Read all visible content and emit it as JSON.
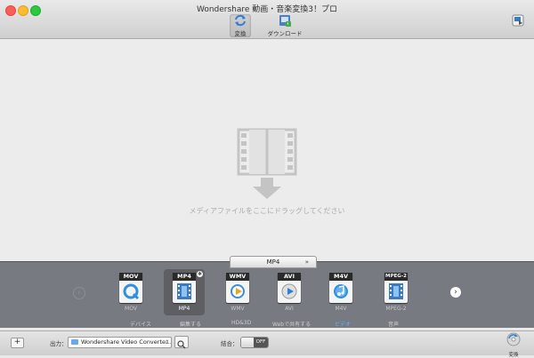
{
  "window": {
    "title": "Wondershare 動画・音楽変換3！プロ"
  },
  "toolbar": {
    "convert_label": "変換",
    "download_label": "ダウンロード"
  },
  "dropzone": {
    "hint": "メディアファイルをここにドラッグしてください"
  },
  "format_dropdown": {
    "selected": "MP4"
  },
  "formats": [
    {
      "tag": "MOV",
      "label": "MOV",
      "icon": "quicktime-icon"
    },
    {
      "tag": "MP4",
      "label": "MP4",
      "icon": "film-strip-icon",
      "selected": true
    },
    {
      "tag": "WMV",
      "label": "WMV",
      "icon": "windows-media-play-icon"
    },
    {
      "tag": "AVI",
      "label": "AVI",
      "icon": "play-icon"
    },
    {
      "tag": "M4V",
      "label": "M4V",
      "icon": "itunes-icon"
    },
    {
      "tag": "MPEG-2",
      "label": "MPEG-2",
      "icon": "film-strip-icon"
    }
  ],
  "categories": [
    {
      "label": "デバイス"
    },
    {
      "label": "編集する"
    },
    {
      "label": "HD&3D"
    },
    {
      "label": "Webで共有する"
    },
    {
      "label": "ビデオ",
      "active": true
    },
    {
      "label": "音声"
    }
  ],
  "bottom": {
    "output_label": "出力：",
    "output_value": "Wondershare Video Converte...",
    "merge_label": "結合：",
    "merge_state": "OFF",
    "convert_label": "変換"
  },
  "colors": {
    "accent_blue": "#5fb0ff",
    "format_bar": "#777a80",
    "close": "#fd5f56",
    "minimize": "#fdbc2e",
    "zoom": "#2ac940"
  }
}
